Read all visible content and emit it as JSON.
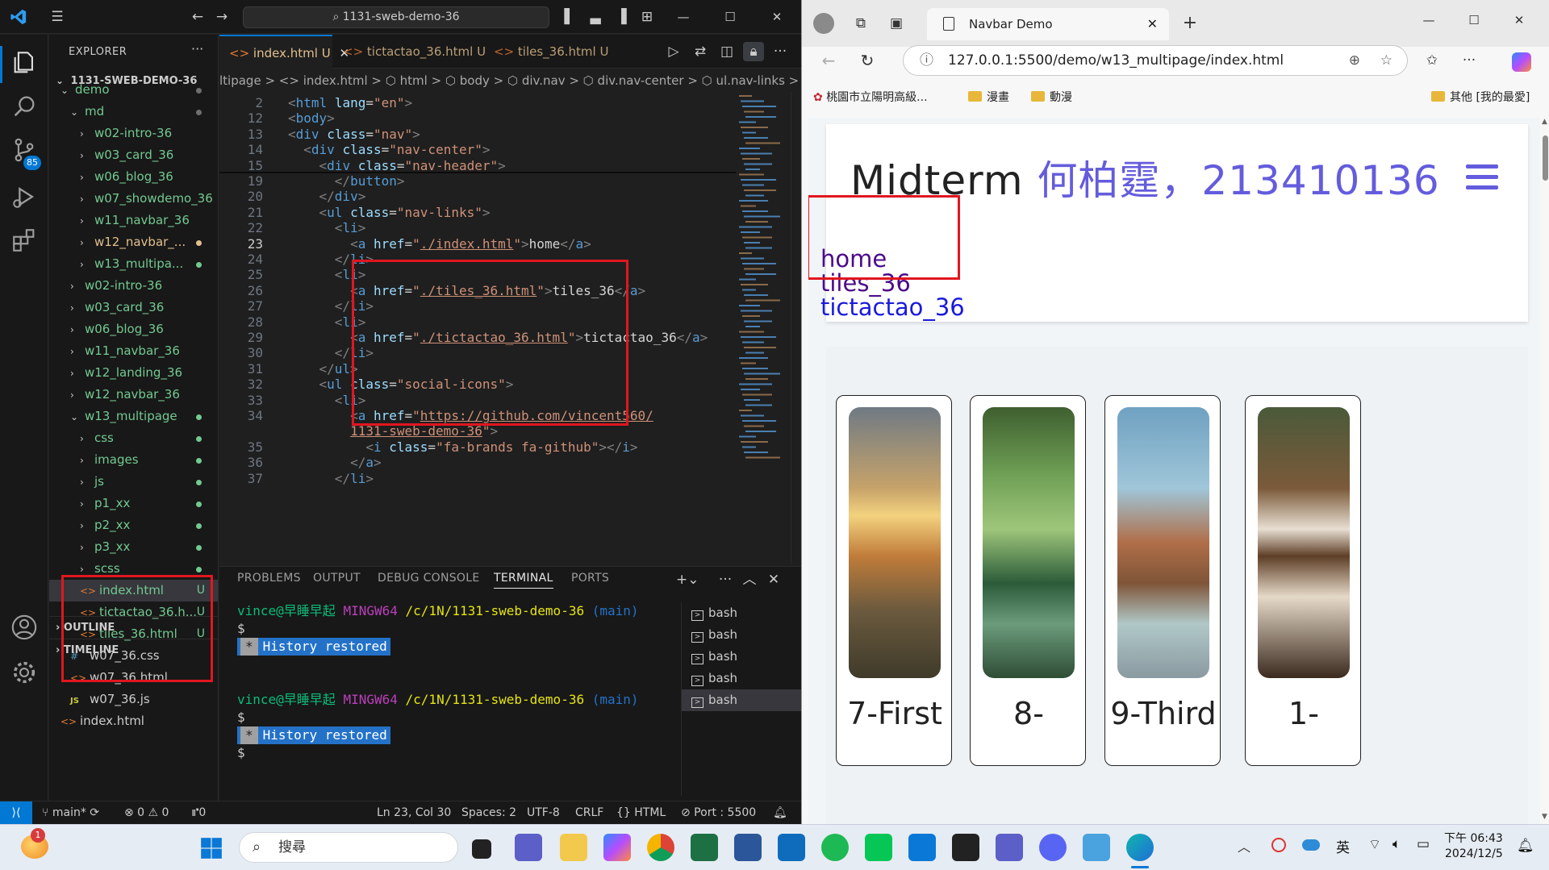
{
  "vscode": {
    "command_center": "1131-sweb-demo-36",
    "explorer_title": "EXPLORER",
    "root": "1131-SWEB-DEMO-36",
    "tree": [
      {
        "label": "demo",
        "chev": "⌄",
        "indent": 1,
        "cls": "green",
        "dot": "#6e6e6e"
      },
      {
        "label": "md",
        "chev": "⌄",
        "indent": 2,
        "cls": "green",
        "dot": "#6e6e6e"
      },
      {
        "label": "w02-intro-36",
        "chev": "›",
        "indent": 3,
        "cls": "green"
      },
      {
        "label": "w03_card_36",
        "chev": "›",
        "indent": 3,
        "cls": "green"
      },
      {
        "label": "w06_blog_36",
        "chev": "›",
        "indent": 3,
        "cls": "green"
      },
      {
        "label": "w07_showdemo_36",
        "chev": "›",
        "indent": 3,
        "cls": "green"
      },
      {
        "label": "w11_navbar_36",
        "chev": "›",
        "indent": 3,
        "cls": "green"
      },
      {
        "label": "w12_navbar_...",
        "chev": "›",
        "indent": 3,
        "cls": "yellow",
        "dot": "#e2c08d"
      },
      {
        "label": "w13_multipa...",
        "chev": "›",
        "indent": 3,
        "cls": "green",
        "dot": "#73c991"
      },
      {
        "label": "w02-intro-36",
        "chev": "›",
        "indent": 2,
        "cls": "green"
      },
      {
        "label": "w03_card_36",
        "chev": "›",
        "indent": 2,
        "cls": "green"
      },
      {
        "label": "w06_blog_36",
        "chev": "›",
        "indent": 2,
        "cls": "green"
      },
      {
        "label": "w11_navbar_36",
        "chev": "›",
        "indent": 2,
        "cls": "green"
      },
      {
        "label": "w12_landing_36",
        "chev": "›",
        "indent": 2,
        "cls": "green"
      },
      {
        "label": "w12_navbar_36",
        "chev": "›",
        "indent": 2,
        "cls": "green"
      },
      {
        "label": "w13_multipage",
        "chev": "⌄",
        "indent": 2,
        "cls": "green",
        "dot": "#73c991"
      },
      {
        "label": "css",
        "chev": "›",
        "indent": 3,
        "cls": "green",
        "dot": "#73c991"
      },
      {
        "label": "images",
        "chev": "›",
        "indent": 3,
        "cls": "green",
        "dot": "#73c991"
      },
      {
        "label": "js",
        "chev": "›",
        "indent": 3,
        "cls": "green",
        "dot": "#73c991"
      },
      {
        "label": "p1_xx",
        "chev": "›",
        "indent": 3,
        "cls": "green",
        "dot": "#73c991"
      },
      {
        "label": "p2_xx",
        "chev": "›",
        "indent": 3,
        "cls": "green",
        "dot": "#73c991"
      },
      {
        "label": "p3_xx",
        "chev": "›",
        "indent": 3,
        "cls": "green",
        "dot": "#73c991"
      },
      {
        "label": "scss",
        "chev": "›",
        "indent": 3,
        "cls": "green",
        "dot": "#73c991"
      },
      {
        "label": "index.html",
        "chev": "<>",
        "indent": 3,
        "cls": "green sel",
        "badge": "U"
      },
      {
        "label": "tictactao_36.h...",
        "chev": "<>",
        "indent": 3,
        "cls": "green",
        "badge": "U"
      },
      {
        "label": "tiles_36.html",
        "chev": "<>",
        "indent": 3,
        "cls": "green",
        "badge": "U"
      },
      {
        "label": "w07_36.css",
        "chev": "#",
        "indent": 2,
        "cls": "plain"
      },
      {
        "label": "w07_36.html",
        "chev": "<>",
        "indent": 2,
        "cls": "plain"
      },
      {
        "label": "w07_36.js",
        "chev": "JS",
        "indent": 2,
        "cls": "plain"
      },
      {
        "label": "index.html",
        "chev": "<>",
        "indent": 1,
        "cls": "plain"
      }
    ],
    "outline": "OUTLINE",
    "timeline": "TIMELINE",
    "tabs": [
      {
        "label": "index.html",
        "badge": "U"
      },
      {
        "label": "tictactao_36.html",
        "badge": "U"
      },
      {
        "label": "tiles_36.html",
        "badge": "U"
      }
    ],
    "breadcrumb": "ltipage > <> index.html > ⬡ html > ⬡ body > ⬡ div.nav > ⬡ div.nav-center > ⬡ ul.nav-links >",
    "code_lines": [
      {
        "n": "2",
        "html": "<span class='t-br'>&lt;</span><span class='t-tag'>html</span> <span class='t-attr'>lang</span>=<span class='t-str'>\"en\"</span><span class='t-br'>&gt;</span>"
      },
      {
        "n": "12",
        "html": "<span class='t-br'>&lt;</span><span class='t-tag'>body</span><span class='t-br'>&gt;</span>"
      },
      {
        "n": "13",
        "html": "<span class='t-br'>&lt;</span><span class='t-tag'>div</span> <span class='t-attr'>class</span>=<span class='t-str'>\"nav\"</span><span class='t-br'>&gt;</span>"
      },
      {
        "n": "14",
        "html": "  <span class='t-br'>&lt;</span><span class='t-tag'>div</span> <span class='t-attr'>class</span>=<span class='t-str'>\"nav-center\"</span><span class='t-br'>&gt;</span>"
      },
      {
        "n": "15",
        "html": "    <span class='t-br'>&lt;</span><span class='t-tag'>div</span> <span class='t-attr'>class</span>=<span class='t-str'>\"nav-header\"</span><span class='t-br'>&gt;</span>"
      },
      {
        "n": "19",
        "html": "      <span class='t-br'>&lt;/</span><span class='t-tag'>button</span><span class='t-br'>&gt;</span>"
      },
      {
        "n": "20",
        "html": "    <span class='t-br'>&lt;/</span><span class='t-tag'>div</span><span class='t-br'>&gt;</span>"
      },
      {
        "n": "21",
        "html": "    <span class='t-br'>&lt;</span><span class='t-tag'>ul</span> <span class='t-attr'>class</span>=<span class='t-str'>\"nav-links\"</span><span class='t-br'>&gt;</span>"
      },
      {
        "n": "22",
        "html": "      <span class='t-br'>&lt;</span><span class='t-tag'>li</span><span class='t-br'>&gt;</span>"
      },
      {
        "n": "23",
        "html": "        <span class='t-br'>&lt;</span><span class='t-tag'>a</span> <span class='t-attr'>href</span>=<span class='t-str'>\"</span><span class='t-url'>./index.html</span><span class='t-str'>\"</span><span class='t-br'>&gt;</span><span class='t-txt'>home</span><span class='t-br'>&lt;/</span><span class='t-tag'>a</span><span class='t-br'>&gt;</span>",
        "cur": true
      },
      {
        "n": "24",
        "html": "      <span class='t-br'>&lt;/</span><span class='t-tag'>li</span><span class='t-br'>&gt;</span>"
      },
      {
        "n": "25",
        "html": "      <span class='t-br'>&lt;</span><span class='t-tag'>li</span><span class='t-br'>&gt;</span>"
      },
      {
        "n": "26",
        "html": "        <span class='t-br'>&lt;</span><span class='t-tag'>a</span> <span class='t-attr'>href</span>=<span class='t-str'>\"</span><span class='t-url'>./tiles_36.html</span><span class='t-str'>\"</span><span class='t-br'>&gt;</span><span class='t-txt'>tiles_36</span><span class='t-br'>&lt;/</span><span class='t-tag'>a</span><span class='t-br'>&gt;</span>"
      },
      {
        "n": "27",
        "html": "      <span class='t-br'>&lt;/</span><span class='t-tag'>li</span><span class='t-br'>&gt;</span>"
      },
      {
        "n": "28",
        "html": "      <span class='t-br'>&lt;</span><span class='t-tag'>li</span><span class='t-br'>&gt;</span>"
      },
      {
        "n": "29",
        "html": "        <span class='t-br'>&lt;</span><span class='t-tag'>a</span> <span class='t-attr'>href</span>=<span class='t-str'>\"</span><span class='t-url'>./tictactao_36.html</span><span class='t-str'>\"</span><span class='t-br'>&gt;</span><span class='t-txt'>tictactao_36</span><span class='t-br'>&lt;/</span><span class='t-tag'>a</span><span class='t-br'>&gt;</span>"
      },
      {
        "n": "30",
        "html": "      <span class='t-br'>&lt;/</span><span class='t-tag'>li</span><span class='t-br'>&gt;</span>"
      },
      {
        "n": "31",
        "html": "    <span class='t-br'>&lt;/</span><span class='t-tag'>ul</span><span class='t-br'>&gt;</span>"
      },
      {
        "n": "32",
        "html": "    <span class='t-br'>&lt;</span><span class='t-tag'>ul</span> <span class='t-attr'>class</span>=<span class='t-str'>\"social-icons\"</span><span class='t-br'>&gt;</span>"
      },
      {
        "n": "33",
        "html": "      <span class='t-br'>&lt;</span><span class='t-tag'>li</span><span class='t-br'>&gt;</span>"
      },
      {
        "n": "34",
        "html": "        <span class='t-br'>&lt;</span><span class='t-tag'>a</span> <span class='t-attr'>href</span>=<span class='t-str'>\"</span><span class='t-url'>https://github.com/vincent560/</span>"
      },
      {
        "n": "",
        "html": "        <span class='t-url'>1131-sweb-demo-36</span><span class='t-str'>\"</span><span class='t-br'>&gt;</span>"
      },
      {
        "n": "35",
        "html": "          <span class='t-br'>&lt;</span><span class='t-tag'>i</span> <span class='t-attr'>class</span>=<span class='t-str'>\"fa-brands fa-github\"</span><span class='t-br'>&gt;&lt;/</span><span class='t-tag'>i</span><span class='t-br'>&gt;</span>"
      },
      {
        "n": "36",
        "html": "        <span class='t-br'>&lt;/</span><span class='t-tag'>a</span><span class='t-br'>&gt;</span>"
      },
      {
        "n": "37",
        "html": "      <span class='t-br'>&lt;/</span><span class='t-tag'>li</span><span class='t-br'>&gt;</span>"
      }
    ],
    "panel_tabs": [
      "PROBLEMS",
      "OUTPUT",
      "DEBUG CONSOLE",
      "TERMINAL",
      "PORTS"
    ],
    "terminal": {
      "user": "vince@早睡早起",
      "env": "MINGW64",
      "path": "/c/1N/1131-sweb-demo-36",
      "branch": "(main)",
      "prompt": "$",
      "restored": "History restored"
    },
    "shells": [
      "bash",
      "bash",
      "bash",
      "bash",
      "bash"
    ],
    "status": {
      "branch": "main*",
      "errors": "⊗ 0 ⚠ 0",
      "ports": "⑈0",
      "position": "Ln 23, Col 30",
      "spaces": "Spaces: 2",
      "encoding": "UTF-8",
      "eol": "CRLF",
      "lang": "{} HTML",
      "port": "⊘ Port : 5500"
    },
    "source_control_badge": "85"
  },
  "browser": {
    "tab_title": "Navbar Demo",
    "url": "127.0.0.1:5500/demo/w13_multipage/index.html",
    "bookmarks": [
      {
        "label": "桃園市立陽明高級...",
        "type": "site"
      },
      {
        "label": "漫畫",
        "type": "folder"
      },
      {
        "label": "動漫",
        "type": "folder"
      }
    ],
    "other_bookmarks": "其他 [我的最愛]",
    "page": {
      "title_main": "Midterm",
      "title_accent": "何柏霆，213410136",
      "links": [
        "home",
        "tiles_36",
        "tictactao_36"
      ],
      "tiles": [
        {
          "caption": "7-First",
          "grad": "linear-gradient(180deg,#6f7a84 0%,#c7a36a 30%,#f3d27e 40%,#c07c3a 55%,#6b5a3e 75%,#3f3a2a 100%)"
        },
        {
          "caption": "8-",
          "grad": "linear-gradient(180deg,#3f5f2f 0%,#6fa055 25%,#9ec67a 45%,#2c5b3a 65%,#6b9b7b 80%,#2f4d35 100%)"
        },
        {
          "caption": "9-Third",
          "grad": "linear-gradient(180deg,#6fa1c1 0%,#9fc6d9 30%,#b06e48 50%,#7f5538 65%,#b0c8c8 80%,#8a9aa0 100%)"
        },
        {
          "caption": "1-",
          "grad": "linear-gradient(180deg,#4a5a3a 0%,#7b5a3a 30%,#e8dfd2 45%,#5e3e26 55%,#e5d9c8 70%,#3b2a1e 100%)"
        }
      ]
    }
  },
  "taskbar": {
    "search_placeholder": "搜尋",
    "ime": "英",
    "time": "下午 06:43",
    "date": "2024/12/5",
    "notify": "1"
  }
}
